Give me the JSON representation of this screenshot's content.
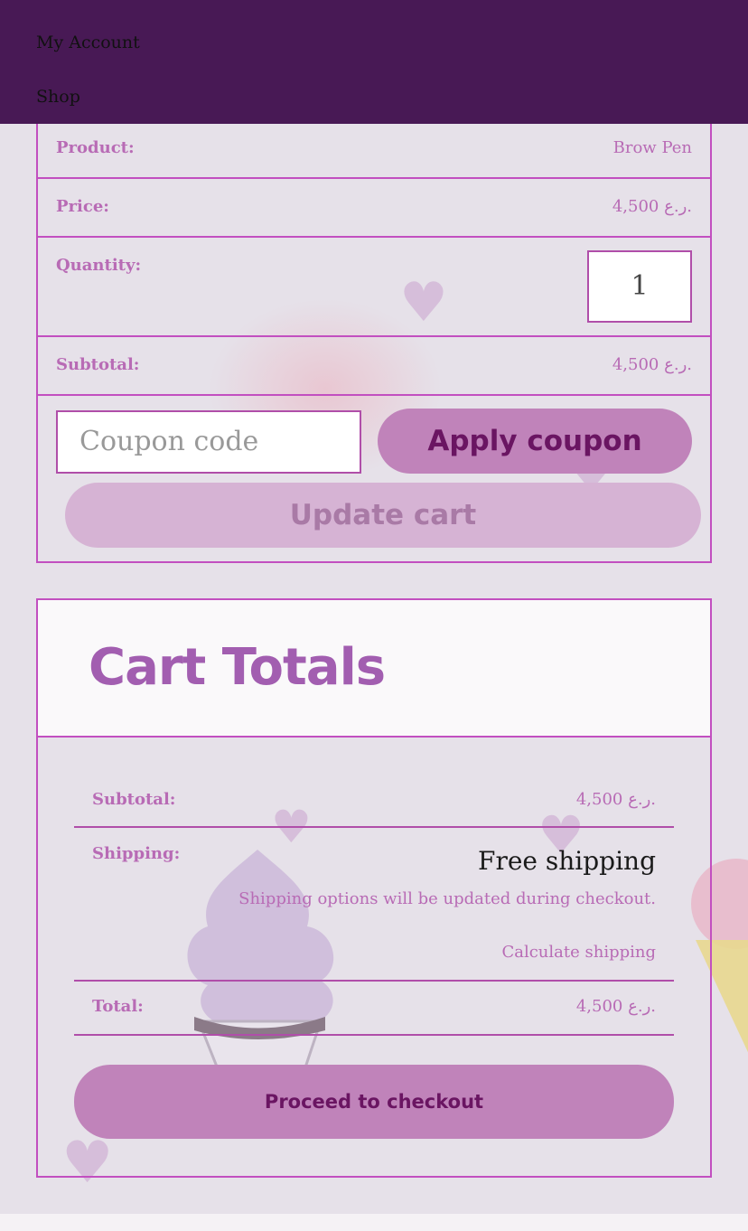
{
  "nav": {
    "my_account": "My Account",
    "shop": "Shop"
  },
  "cart": {
    "product_label": "Product:",
    "product_value": "Brow Pen",
    "price_label": "Price:",
    "price_value": "4,500 ر.ع.",
    "quantity_label": "Quantity:",
    "quantity_value": "1",
    "subtotal_label": "Subtotal:",
    "subtotal_value": "4,500 ر.ع.",
    "coupon_placeholder": "Coupon code",
    "apply_coupon": "Apply coupon",
    "update_cart": "Update cart"
  },
  "totals": {
    "title": "Cart Totals",
    "subtotal_label": "Subtotal:",
    "subtotal_value": "4,500 ر.ع.",
    "shipping_label": "Shipping:",
    "shipping_method": "Free shipping",
    "shipping_note": "Shipping options will be updated during checkout.",
    "calculate_shipping": "Calculate shipping",
    "total_label": "Total:",
    "total_value": "4,500 ر.ع.",
    "checkout": "Proceed to checkout"
  },
  "colors": {
    "nav_bg": "#481955",
    "accent": "#c24fc0",
    "button": "#c083ba",
    "title": "#a25eb0"
  },
  "icons": [
    "heart-icon",
    "cupcake-illustration",
    "ice-cream-cone-illustration"
  ]
}
